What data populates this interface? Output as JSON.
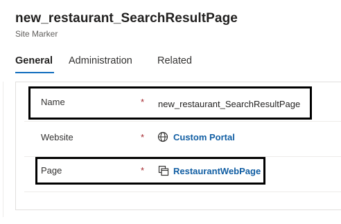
{
  "header": {
    "title": "new_restaurant_SearchResultPage",
    "subtitle": "Site Marker"
  },
  "tabs": [
    {
      "label": "General",
      "active": true
    },
    {
      "label": "Administration",
      "active": false
    },
    {
      "label": "Related",
      "active": false
    }
  ],
  "fields": {
    "name": {
      "label": "Name",
      "required": "*",
      "value": "new_restaurant_SearchResultPage"
    },
    "website": {
      "label": "Website",
      "required": "*",
      "value": "Custom Portal",
      "icon": "globe-icon"
    },
    "page": {
      "label": "Page",
      "required": "*",
      "value": "RestaurantWebPage",
      "icon": "webpage-icon"
    }
  },
  "colors": {
    "accent": "#0f6cbd",
    "link": "#115ea3",
    "required": "#a4262c",
    "highlight": "#000000"
  }
}
